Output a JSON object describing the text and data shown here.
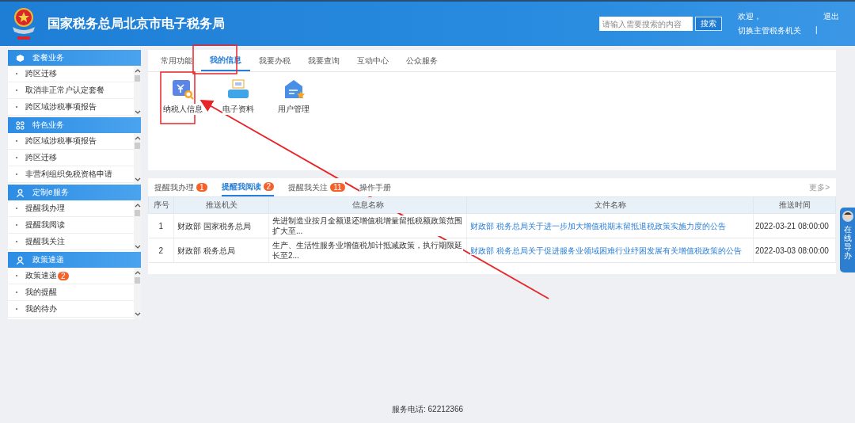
{
  "header": {
    "title": "国家税务总局北京市电子税务局",
    "search": {
      "placeholder": "请输入需要搜索的内容",
      "button": "搜索"
    },
    "welcome": "欢迎，",
    "logout": "退出",
    "switch_authority": "切换主管税务机关",
    "separator": "|"
  },
  "sidebar": [
    {
      "title": "套餐业务",
      "items": [
        {
          "label": "跨区迁移"
        },
        {
          "label": "取消非正常户认定套餐"
        },
        {
          "label": "跨区域涉税事项报告"
        }
      ]
    },
    {
      "title": "特色业务",
      "items": [
        {
          "label": "跨区域涉税事项报告"
        },
        {
          "label": "跨区迁移"
        },
        {
          "label": "非营利组织免税资格申请"
        }
      ]
    },
    {
      "title": "定制e服务",
      "items": [
        {
          "label": "提醒我办理"
        },
        {
          "label": "提醒我阅读"
        },
        {
          "label": "提醒我关注"
        }
      ]
    },
    {
      "title": "政策速递",
      "items": [
        {
          "label": "政策速递",
          "badge": "2"
        },
        {
          "label": "我的提醒"
        },
        {
          "label": "我的待办"
        }
      ]
    }
  ],
  "tabs": [
    {
      "label": "常用功能",
      "selected": false
    },
    {
      "label": "我的信息",
      "selected": true
    },
    {
      "label": "我要办税",
      "selected": false
    },
    {
      "label": "我要查询",
      "selected": false
    },
    {
      "label": "互动中心",
      "selected": false
    },
    {
      "label": "公众服务",
      "selected": false
    }
  ],
  "functions": [
    {
      "label": "纳税人信息"
    },
    {
      "label": "电子资料"
    },
    {
      "label": "用户管理"
    }
  ],
  "reminder_tabs": [
    {
      "label": "提醒我办理",
      "count": "1",
      "selected": false
    },
    {
      "label": "提醒我阅读",
      "count": "2",
      "selected": true
    },
    {
      "label": "提醒我关注",
      "count": "11",
      "selected": false
    },
    {
      "label": "操作手册",
      "selected": false
    }
  ],
  "more": "更多>",
  "table": {
    "columns": [
      "序号",
      "推送机关",
      "信息名称",
      "文件名称",
      "推送时间"
    ],
    "rows": [
      [
        "1",
        "财政部 国家税务总局",
        "先进制造业按月全额退还增值税增量留抵税额政策范围扩大至...",
        "财政部 税务总局关于进一步加大增值税期末留抵退税政策实施力度的公告",
        "2022-03-21 08:00:00"
      ],
      [
        "2",
        "财政部 税务总局",
        "生产、生活性服务业增值税加计抵减政策，执行期限延长至2...",
        "财政部 税务总局关于促进服务业领域困难行业纾困发展有关增值税政策的公告",
        "2022-03-03 08:00:00"
      ]
    ]
  },
  "online_guide": "在线导办",
  "footer": "服务电话: 62212366"
}
